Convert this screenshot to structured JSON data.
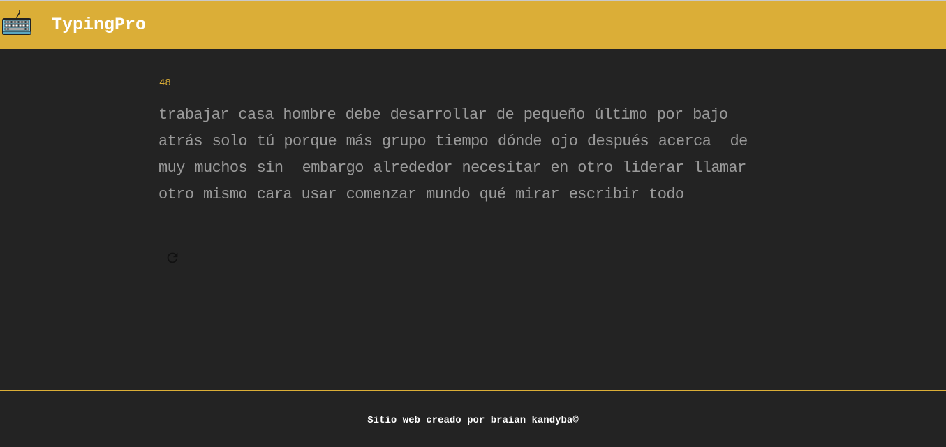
{
  "header": {
    "brand": "TypingPro",
    "logo_icon": "keyboard-icon",
    "background": "#dbae37"
  },
  "test": {
    "counter": "48",
    "words": [
      "trabajar casa hombre debe desarrollar de pequeño último por bajo",
      "atrás solo tú porque más grupo tiempo dónde ojo después acerca  de",
      "muy muchos sin  embargo alrededor necesitar en otro liderar llamar",
      "otro mismo cara usar comenzar mundo qué mirar escribir todo"
    ],
    "restart_icon": "refresh-icon"
  },
  "footer": {
    "text": "Sitio web creado por braian kandyba©"
  },
  "colors": {
    "accent": "#dbae37",
    "background": "#232323",
    "text": "#9a9a9a"
  }
}
